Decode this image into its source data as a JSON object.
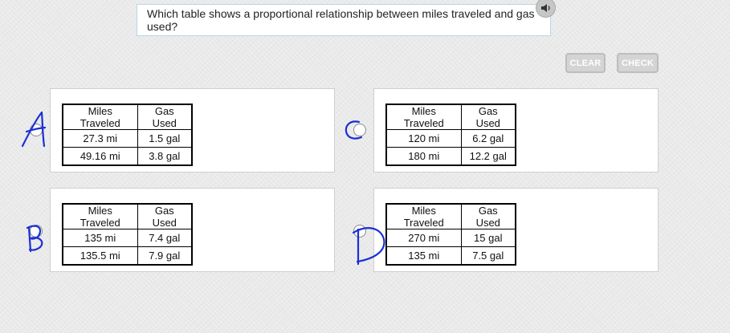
{
  "question": {
    "text": "Which table shows a proportional relationship between miles traveled and gas used?",
    "audio_icon": "speaker-icon"
  },
  "buttons": {
    "clear": "CLEAR",
    "check": "CHECK"
  },
  "options": {
    "a": {
      "handwritten_letter": "A",
      "headers": [
        "Miles Traveled",
        "Gas Used"
      ],
      "rows": [
        [
          "27.3 mi",
          "1.5 gal"
        ],
        [
          "49.16 mi",
          "3.8 gal"
        ]
      ]
    },
    "b": {
      "handwritten_letter": "B",
      "headers": [
        "Miles Traveled",
        "Gas Used"
      ],
      "rows": [
        [
          "135 mi",
          "7.4 gal"
        ],
        [
          "135.5 mi",
          "7.9 gal"
        ]
      ]
    },
    "c": {
      "handwritten_letter": "C",
      "headers": [
        "Miles Traveled",
        "Gas Used"
      ],
      "rows": [
        [
          "120 mi",
          "6.2 gal"
        ],
        [
          "180 mi",
          "12.2 gal"
        ]
      ]
    },
    "d": {
      "handwritten_letter": "D",
      "headers": [
        "Miles Traveled",
        "Gas Used"
      ],
      "rows": [
        [
          "270 mi",
          "15 gal"
        ],
        [
          "135 mi",
          "7.5 gal"
        ]
      ]
    }
  },
  "colors": {
    "ink": "#1b2fd6",
    "question_border": "#b8d6e4",
    "button_bg": "#d4d4d4"
  }
}
